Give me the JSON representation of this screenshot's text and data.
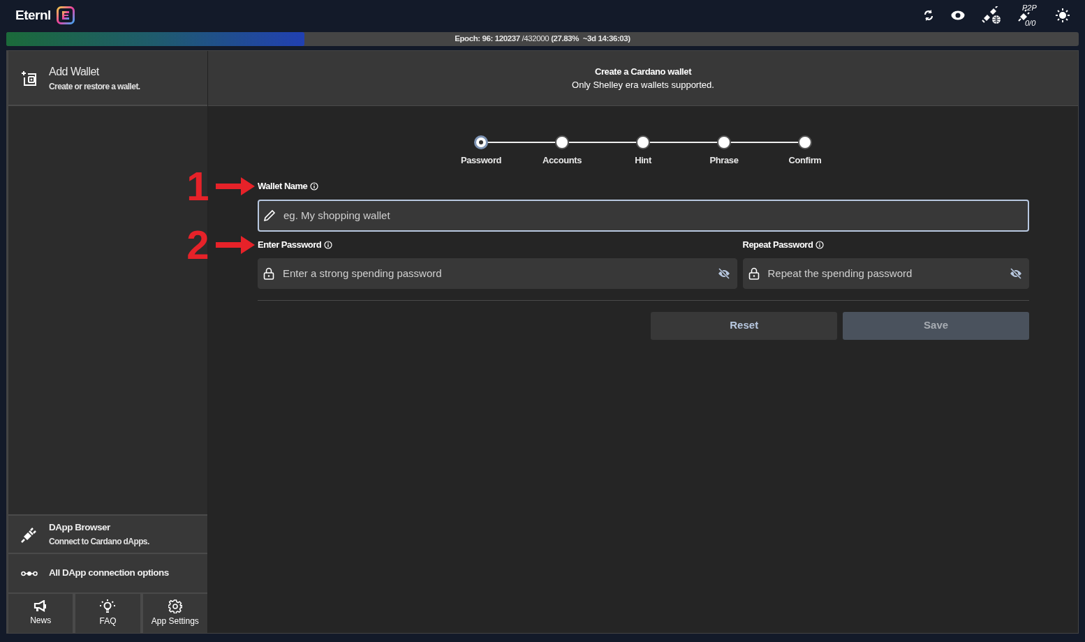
{
  "app": {
    "name": "Eternl"
  },
  "toolbar": {
    "p2p_label": "P2P",
    "p2p_count": "0/0"
  },
  "epoch": {
    "text": "**Epoch: 96: 120237** /432000 **(27.83%  ~3d 14:36:03)**",
    "level": 0.2783
  },
  "sidebar": {
    "header": {
      "title": "Add Wallet",
      "subtitle": "Create or restore a wallet."
    },
    "dapp_browser": {
      "title": "DApp Browser",
      "subtitle": "Connect to Cardano dApps."
    },
    "dapp_options": {
      "label": "All DApp connection options"
    },
    "footer": [
      {
        "kind": "news",
        "label": "News"
      },
      {
        "kind": "faq",
        "label": "FAQ"
      },
      {
        "kind": "settings",
        "label": "App Settings"
      }
    ]
  },
  "main": {
    "header": {
      "title": "Create a Cardano wallet",
      "subtitle": "Only Shelley era wallets supported."
    },
    "steps": [
      {
        "label": "Password",
        "selected": true
      },
      {
        "label": "Accounts",
        "selected": false
      },
      {
        "label": "Hint",
        "selected": false
      },
      {
        "label": "Phrase",
        "selected": false
      },
      {
        "label": "Confirm",
        "selected": false
      }
    ],
    "wallet_name": {
      "annotation": "1",
      "label": "Wallet Name",
      "placeholder": "eg. My shopping wallet",
      "focused": true
    },
    "password": {
      "annotation": "2",
      "label": "Enter Password",
      "placeholder": "Enter a strong spending password"
    },
    "repeat_password": {
      "label": "Repeat Password",
      "placeholder": "Repeat the spending password"
    },
    "buttons": [
      {
        "label": "Reset",
        "disabled": false
      },
      {
        "label": "Save",
        "disabled": true
      }
    ]
  }
}
